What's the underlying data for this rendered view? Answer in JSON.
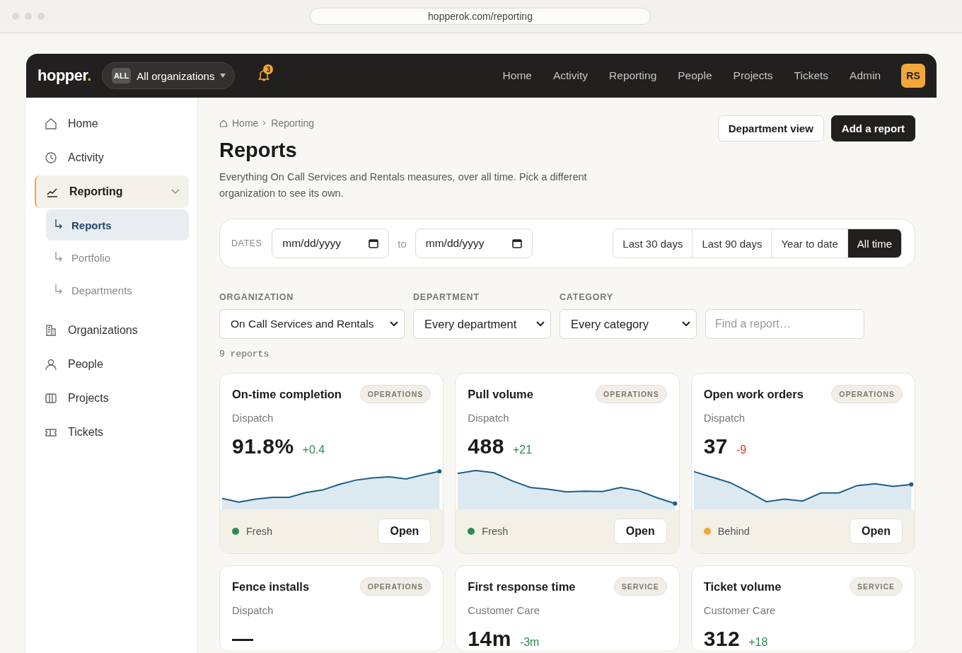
{
  "browser": {
    "url": "hopperok.com/reporting"
  },
  "topbar": {
    "logo": "hopper",
    "logo_dot": ".",
    "org_switch": {
      "badge": "ALL",
      "label": "All organizations"
    },
    "notifications": {
      "count": "3"
    },
    "nav": [
      {
        "label": "Home",
        "selected": false
      },
      {
        "label": "Activity",
        "selected": false
      },
      {
        "label": "Reporting",
        "selected": false
      },
      {
        "label": "People",
        "selected": false
      },
      {
        "label": "Projects",
        "selected": false
      },
      {
        "label": "Tickets",
        "selected": false
      },
      {
        "label": "Admin",
        "selected": false
      }
    ],
    "avatar": "RS"
  },
  "sidebar": {
    "items": [
      {
        "label": "Home",
        "selected": false
      },
      {
        "label": "Activity",
        "selected": false
      },
      {
        "label": "Reporting",
        "selected": true,
        "expanded": true,
        "children": [
          {
            "label": "Reports",
            "selected": true
          },
          {
            "label": "Portfolio",
            "selected": false
          },
          {
            "label": "Departments",
            "selected": false
          }
        ]
      },
      {
        "label": "Organizations",
        "selected": false
      },
      {
        "label": "People",
        "selected": false
      },
      {
        "label": "Projects",
        "selected": false
      },
      {
        "label": "Tickets",
        "selected": false
      }
    ]
  },
  "breadcrumb": [
    "Home",
    "Reporting"
  ],
  "actions": [
    {
      "label": "Department view",
      "kind": "secondary"
    },
    {
      "label": "Add a report",
      "kind": "primary"
    }
  ],
  "title": "Reports",
  "description": "Everything On Call Services and Rentals measures, over all time. Pick a different organization to see its own.",
  "dates": {
    "label": "DATES",
    "from": {
      "placeholder": "mm/dd/yyyy"
    },
    "separator": "to",
    "to": {
      "placeholder": "mm/dd/yyyy"
    },
    "ranges": [
      {
        "label": "Last 30 days",
        "selected": false
      },
      {
        "label": "Last 90 days",
        "selected": false
      },
      {
        "label": "Year to date",
        "selected": false
      },
      {
        "label": "All time",
        "selected": true
      }
    ]
  },
  "filters": [
    {
      "label": "ORGANIZATION",
      "value": "On Call Services and Rentals"
    },
    {
      "label": "DEPARTMENT",
      "value": "Every department"
    },
    {
      "label": "CATEGORY",
      "value": "Every category"
    }
  ],
  "search": {
    "placeholder": "Find a report…"
  },
  "count": "9 reports",
  "cards": [
    {
      "title": "On-time completion",
      "tag": "OPERATIONS",
      "department": "Dispatch",
      "value": "91.8%",
      "delta": {
        "text": "+0.4",
        "color": "#2e8b57"
      },
      "status": "Fresh",
      "color": "#2e8b57",
      "action": "Open"
    },
    {
      "title": "Pull volume",
      "tag": "OPERATIONS",
      "department": "Dispatch",
      "value": "488",
      "delta": {
        "text": "+21",
        "color": "#2e8b57"
      },
      "status": "Fresh",
      "color": "#2e8b57",
      "action": "Open"
    },
    {
      "title": "Open work orders",
      "tag": "OPERATIONS",
      "department": "Dispatch",
      "value": "37",
      "delta": {
        "text": "-9",
        "color": "#d63a2f"
      },
      "status": "Behind",
      "color": "#f0a83a",
      "action": "Open"
    },
    {
      "title": "Fence installs",
      "tag": "OPERATIONS",
      "department": "Dispatch",
      "value": "—"
    },
    {
      "title": "First response time",
      "tag": "SERVICE",
      "department": "Customer Care",
      "value": "14m",
      "delta": {
        "text": "-3m",
        "color": "#2e8b57"
      }
    },
    {
      "title": "Ticket volume",
      "tag": "SERVICE",
      "department": "Customer Care",
      "value": "312",
      "delta": {
        "text": "+18",
        "color": "#2e8b57"
      }
    }
  ]
}
